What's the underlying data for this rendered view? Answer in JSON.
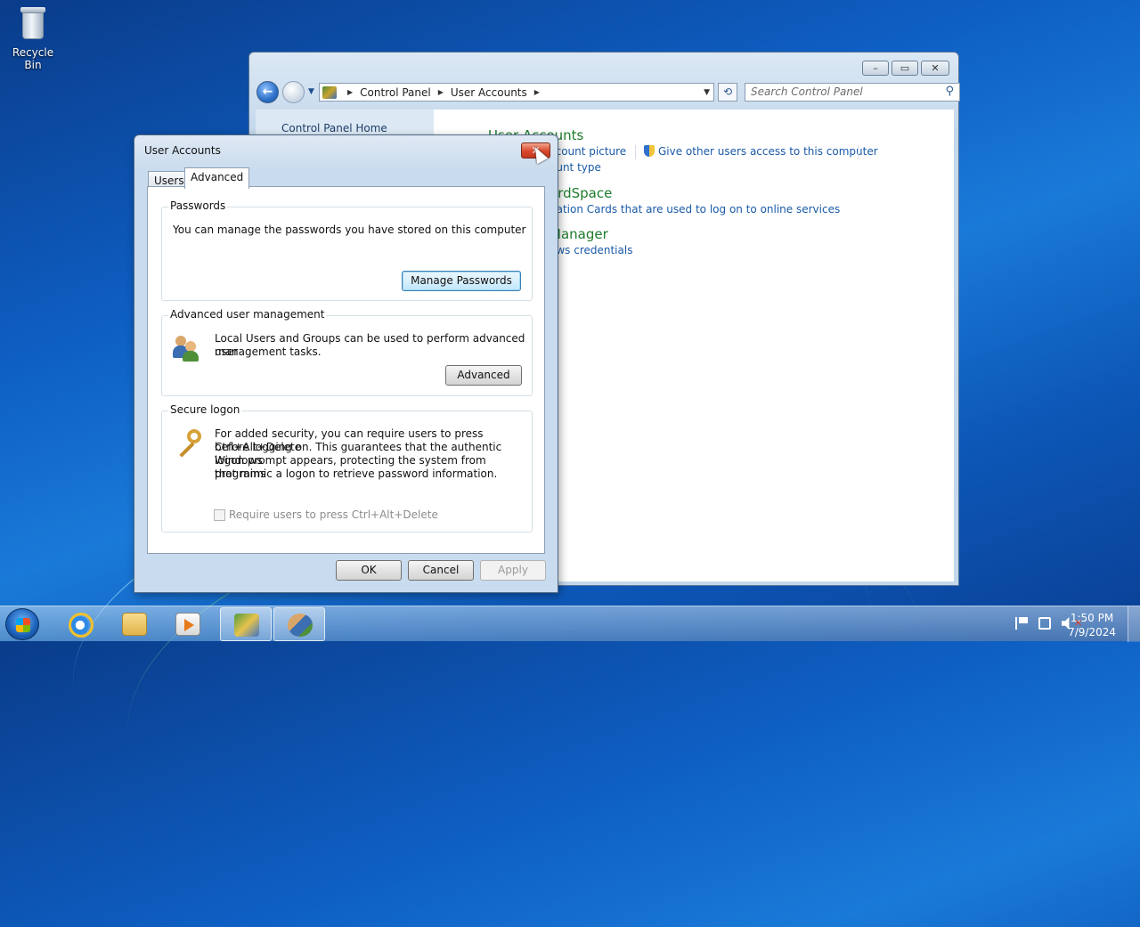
{
  "desktop": {
    "recycle_bin_label": "Recycle Bin"
  },
  "control_panel": {
    "address": {
      "crumb1": "Control Panel",
      "crumb2": "User Accounts"
    },
    "search_placeholder": "Search Control Panel",
    "left_nav": {
      "home": "Control Panel Home"
    },
    "main": {
      "section1_title": "User Accounts",
      "link_picture": "ccount picture",
      "link_give_access": "Give other users access to this computer",
      "link_account_type": "ount type",
      "section2_title": "ardSpace",
      "link_cards": "nation Cards that are used to log on to online services",
      "section3_title": "Manager",
      "link_credentials": "ows credentials"
    }
  },
  "dialog": {
    "title": "User Accounts",
    "tabs": [
      "Users",
      "Advanced"
    ],
    "passwords": {
      "label": "Passwords",
      "text": "You can manage the passwords you have stored on this computer",
      "button": "Manage Passwords"
    },
    "advanced_mgmt": {
      "label": "Advanced user management",
      "text_line1": "Local Users and Groups can be used to perform advanced user",
      "text_line2": "management tasks.",
      "button": "Advanced"
    },
    "secure_logon": {
      "label": "Secure logon",
      "text_line1": "For added security, you can require users to press Ctrl+Alt+Delete",
      "text_line2": "before logging on. This guarantees that the authentic Windows",
      "text_line3": "logon prompt appears, protecting the system from programs",
      "text_line4": "that mimic a logon to retrieve password information.",
      "checkbox_label": "Require users to press Ctrl+Alt+Delete",
      "checkbox_checked": false
    },
    "buttons": {
      "ok": "OK",
      "cancel": "Cancel",
      "apply": "Apply"
    }
  },
  "taskbar": {
    "clock_time": "1:50 PM",
    "clock_date": "7/9/2024"
  }
}
